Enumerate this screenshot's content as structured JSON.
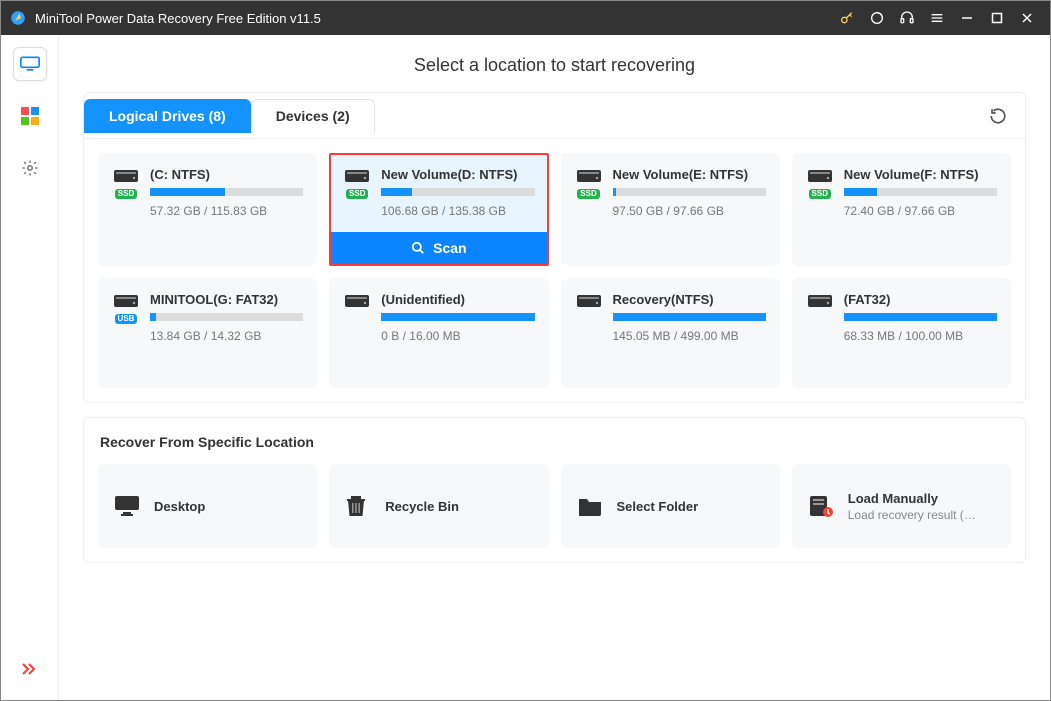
{
  "window": {
    "title": "MiniTool Power Data Recovery Free Edition v11.5"
  },
  "heading": "Select a location to start recovering",
  "tabs": {
    "logical": "Logical Drives (8)",
    "devices": "Devices (2)"
  },
  "scan_label": "Scan",
  "drives": [
    {
      "name": "(C: NTFS)",
      "size": "57.32 GB / 115.83 GB",
      "pct": 49,
      "badge": "SSD",
      "badgeColor": "ssd",
      "selected": false
    },
    {
      "name": "New Volume(D: NTFS)",
      "size": "106.68 GB / 135.38 GB",
      "pct": 20,
      "badge": "SSD",
      "badgeColor": "ssd",
      "selected": true
    },
    {
      "name": "New Volume(E: NTFS)",
      "size": "97.50 GB / 97.66 GB",
      "pct": 2,
      "badge": "SSD",
      "badgeColor": "ssd",
      "selected": false
    },
    {
      "name": "New Volume(F: NTFS)",
      "size": "72.40 GB / 97.66 GB",
      "pct": 22,
      "badge": "SSD",
      "badgeColor": "ssd",
      "selected": false
    },
    {
      "name": "MINITOOL(G: FAT32)",
      "size": "13.84 GB / 14.32 GB",
      "pct": 4,
      "badge": "USB",
      "badgeColor": "usb",
      "selected": false
    },
    {
      "name": "(Unidentified)",
      "size": "0 B / 16.00 MB",
      "pct": 100,
      "badge": "",
      "badgeColor": "",
      "selected": false
    },
    {
      "name": "Recovery(NTFS)",
      "size": "145.05 MB / 499.00 MB",
      "pct": 100,
      "badge": "",
      "badgeColor": "",
      "selected": false
    },
    {
      "name": "(FAT32)",
      "size": "68.33 MB / 100.00 MB",
      "pct": 100,
      "badge": "",
      "badgeColor": "",
      "selected": false
    }
  ],
  "recover_section": "Recover From Specific Location",
  "locations": [
    {
      "label": "Desktop",
      "sub": "",
      "icon": "desktop"
    },
    {
      "label": "Recycle Bin",
      "sub": "",
      "icon": "trash"
    },
    {
      "label": "Select Folder",
      "sub": "",
      "icon": "folder"
    },
    {
      "label": "Load Manually",
      "sub": "Load recovery result (*...",
      "icon": "load"
    }
  ]
}
